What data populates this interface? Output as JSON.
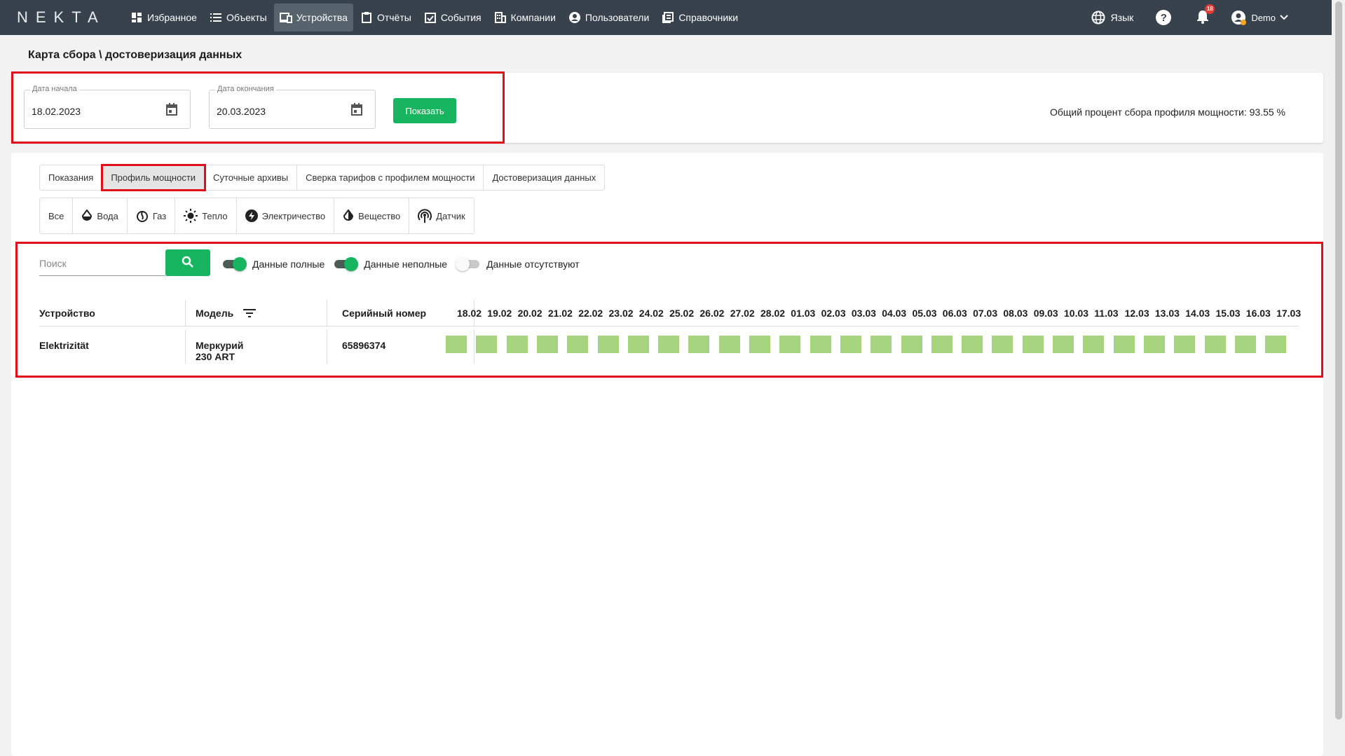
{
  "brand": "NEKTA",
  "nav": [
    {
      "label": "Избранное",
      "icon": "dashboard-icon"
    },
    {
      "label": "Объекты",
      "icon": "list-icon"
    },
    {
      "label": "Устройства",
      "icon": "devices-icon",
      "active": true
    },
    {
      "label": "Отчёты",
      "icon": "clipboard-icon"
    },
    {
      "label": "События",
      "icon": "event-icon"
    },
    {
      "label": "Компании",
      "icon": "building-icon"
    },
    {
      "label": "Пользователи",
      "icon": "account-icon"
    },
    {
      "label": "Справочники",
      "icon": "library-icon"
    }
  ],
  "header_right": {
    "language_label": "Язык",
    "notifications_count": "18",
    "user_name": "Demo"
  },
  "page_title": "Карта сбора \\ достоверизация данных",
  "filters": {
    "start_label": "Дата начала",
    "start_value": "18.02.2023",
    "end_label": "Дата окончания",
    "end_value": "20.03.2023",
    "show_button": "Показать",
    "total_text": "Общий процент сбора профиля мощности: 93.55 %"
  },
  "tabs": [
    {
      "label": "Показания"
    },
    {
      "label": "Профиль мощности",
      "active": true
    },
    {
      "label": "Суточные архивы"
    },
    {
      "label": "Сверка тарифов с профилем мощности"
    },
    {
      "label": "Достоверизация данных"
    }
  ],
  "resource_types": [
    {
      "label": "Все",
      "icon": ""
    },
    {
      "label": "Вода",
      "icon": "water-drop-icon"
    },
    {
      "label": "Газ",
      "icon": "gas-icon"
    },
    {
      "label": "Тепло",
      "icon": "sun-icon"
    },
    {
      "label": "Электричество",
      "icon": "lightning-icon"
    },
    {
      "label": "Вещество",
      "icon": "substance-icon"
    },
    {
      "label": "Датчик",
      "icon": "sensor-icon"
    }
  ],
  "search": {
    "placeholder": "Поиск"
  },
  "toggles": [
    {
      "label": "Данные полные",
      "on": true
    },
    {
      "label": "Данные неполные",
      "on": true
    },
    {
      "label": "Данные отсутствуют",
      "on": false
    }
  ],
  "table": {
    "headers": {
      "device": "Устройство",
      "model": "Модель",
      "serial": "Серийный номер"
    },
    "dates": [
      "18.02",
      "19.02",
      "20.02",
      "21.02",
      "22.02",
      "23.02",
      "24.02",
      "25.02",
      "26.02",
      "27.02",
      "28.02",
      "01.03",
      "02.03",
      "03.03",
      "04.03",
      "05.03",
      "06.03",
      "07.03",
      "08.03",
      "09.03",
      "10.03",
      "11.03",
      "12.03",
      "13.03",
      "14.03",
      "15.03",
      "16.03",
      "17.03"
    ],
    "rows": [
      {
        "device": "Elektrizität",
        "model": "Меркурий 230 ART",
        "serial": "65896374",
        "status_color": "#a6d47f"
      }
    ]
  },
  "colors": {
    "accent": "#17b55f",
    "topbar": "#37424c",
    "highlight": "#e0101a",
    "complete": "#a6d47f"
  }
}
